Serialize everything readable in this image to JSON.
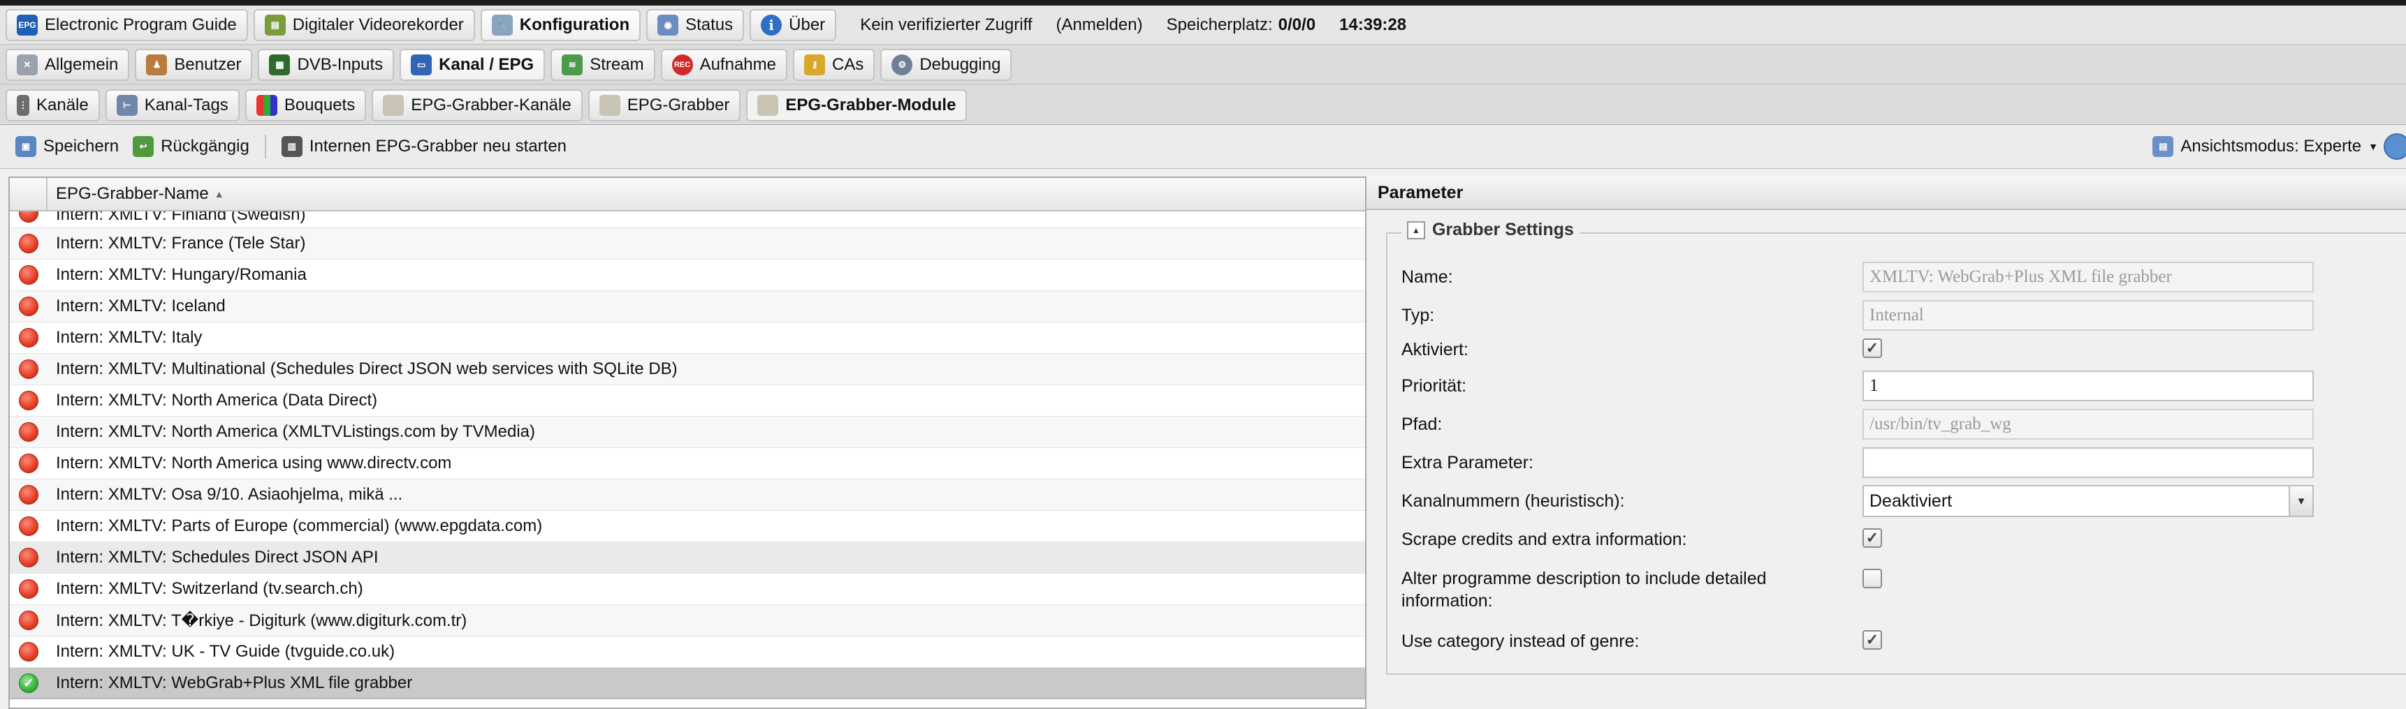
{
  "tabs_main": [
    {
      "label": "Electronic Program Guide",
      "icon": "epg-icon",
      "icon_text": "EPG",
      "active": false
    },
    {
      "label": "Digitaler Videorekorder",
      "icon": "dvr-icon",
      "icon_text": "",
      "active": false
    },
    {
      "label": "Konfiguration",
      "icon": "wrench-icon",
      "icon_text": "",
      "active": true
    },
    {
      "label": "Status",
      "icon": "eye-icon",
      "icon_text": "",
      "active": false
    },
    {
      "label": "Über",
      "icon": "info-icon",
      "icon_text": "i",
      "active": false
    }
  ],
  "status": {
    "access": "Kein verifizierter Zugriff",
    "login": "(Anmelden)",
    "storage_label": "Speicherplatz:",
    "storage_value": "0/0/0",
    "time": "14:39:28"
  },
  "tabs_config": [
    {
      "label": "Allgemein",
      "icon": "tools-icon",
      "active": false
    },
    {
      "label": "Benutzer",
      "icon": "users-icon",
      "active": false
    },
    {
      "label": "DVB-Inputs",
      "icon": "dvb-card-icon",
      "active": false
    },
    {
      "label": "Kanal / EPG",
      "icon": "tv-icon",
      "active": true
    },
    {
      "label": "Stream",
      "icon": "stream-icon",
      "active": false
    },
    {
      "label": "Aufnahme",
      "icon": "rec-icon",
      "icon_text": "REC",
      "active": false
    },
    {
      "label": "CAs",
      "icon": "key-icon",
      "active": false
    },
    {
      "label": "Debugging",
      "icon": "gears-icon",
      "active": false
    }
  ],
  "tabs_channel": [
    {
      "label": "Kanäle",
      "icon": "remote-icon",
      "active": false
    },
    {
      "label": "Kanal-Tags",
      "icon": "tag-tree-icon",
      "active": false
    },
    {
      "label": "Bouquets",
      "icon": "bouquet-grid-icon",
      "active": false
    },
    {
      "label": "EPG-Grabber-Kanäle",
      "icon": "page-icon",
      "active": false
    },
    {
      "label": "EPG-Grabber",
      "icon": "page-icon",
      "active": false
    },
    {
      "label": "EPG-Grabber-Module",
      "icon": "page-icon",
      "active": true
    }
  ],
  "toolbar": {
    "save": "Speichern",
    "undo": "Rückgängig",
    "restart": "Internen EPG-Grabber neu starten",
    "view_mode": "Ansichtsmodus: Experte"
  },
  "grid": {
    "column_name": "EPG-Grabber-Name",
    "rows": [
      {
        "name": "Intern: XMLTV: Finland (Swedish)",
        "enabled": false
      },
      {
        "name": "Intern: XMLTV: France (Tele Star)",
        "enabled": false
      },
      {
        "name": "Intern: XMLTV: Hungary/Romania",
        "enabled": false
      },
      {
        "name": "Intern: XMLTV: Iceland",
        "enabled": false
      },
      {
        "name": "Intern: XMLTV: Italy",
        "enabled": false
      },
      {
        "name": "Intern: XMLTV: Multinational (Schedules Direct JSON web services with SQLite DB)",
        "enabled": false
      },
      {
        "name": "Intern: XMLTV: North America (Data Direct)",
        "enabled": false
      },
      {
        "name": "Intern: XMLTV: North America (XMLTVListings.com by TVMedia)",
        "enabled": false
      },
      {
        "name": "Intern: XMLTV: North America using www.directv.com",
        "enabled": false
      },
      {
        "name": "Intern: XMLTV: Osa 9/10. Asiaohjelma, mikä ...",
        "enabled": false
      },
      {
        "name": "Intern: XMLTV: Parts of Europe (commercial) (www.epgdata.com)",
        "enabled": false
      },
      {
        "name": "Intern: XMLTV: Schedules Direct JSON API",
        "enabled": false
      },
      {
        "name": "Intern: XMLTV: Switzerland (tv.search.ch)",
        "enabled": false
      },
      {
        "name": "Intern: XMLTV: T�rkiye - Digiturk (www.digiturk.com.tr)",
        "enabled": false
      },
      {
        "name": "Intern: XMLTV: UK - TV Guide (tvguide.co.uk)",
        "enabled": false
      },
      {
        "name": "Intern: XMLTV: WebGrab+Plus XML file grabber",
        "enabled": true
      }
    ]
  },
  "panel": {
    "title": "Parameter",
    "fieldset_title": "Grabber Settings",
    "fields": {
      "name": {
        "label": "Name:",
        "value": "XMLTV: WebGrab+Plus XML file grabber"
      },
      "type": {
        "label": "Typ:",
        "value": "Internal"
      },
      "enabled": {
        "label": "Aktiviert:",
        "checked": true
      },
      "priority": {
        "label": "Priorität:",
        "value": "1"
      },
      "path": {
        "label": "Pfad:",
        "value": "/usr/bin/tv_grab_wg"
      },
      "extra": {
        "label": "Extra Parameter:",
        "value": ""
      },
      "channel_numbers": {
        "label": "Kanalnummern (heuristisch):",
        "value": "Deaktiviert"
      },
      "scrape": {
        "label": "Scrape credits and extra information:",
        "checked": true
      },
      "alter_desc": {
        "label_line1": "Alter programme description to include detailed",
        "label_line2": "information:",
        "checked": false
      },
      "use_category": {
        "label": "Use category instead of genre:",
        "checked": true
      }
    }
  }
}
